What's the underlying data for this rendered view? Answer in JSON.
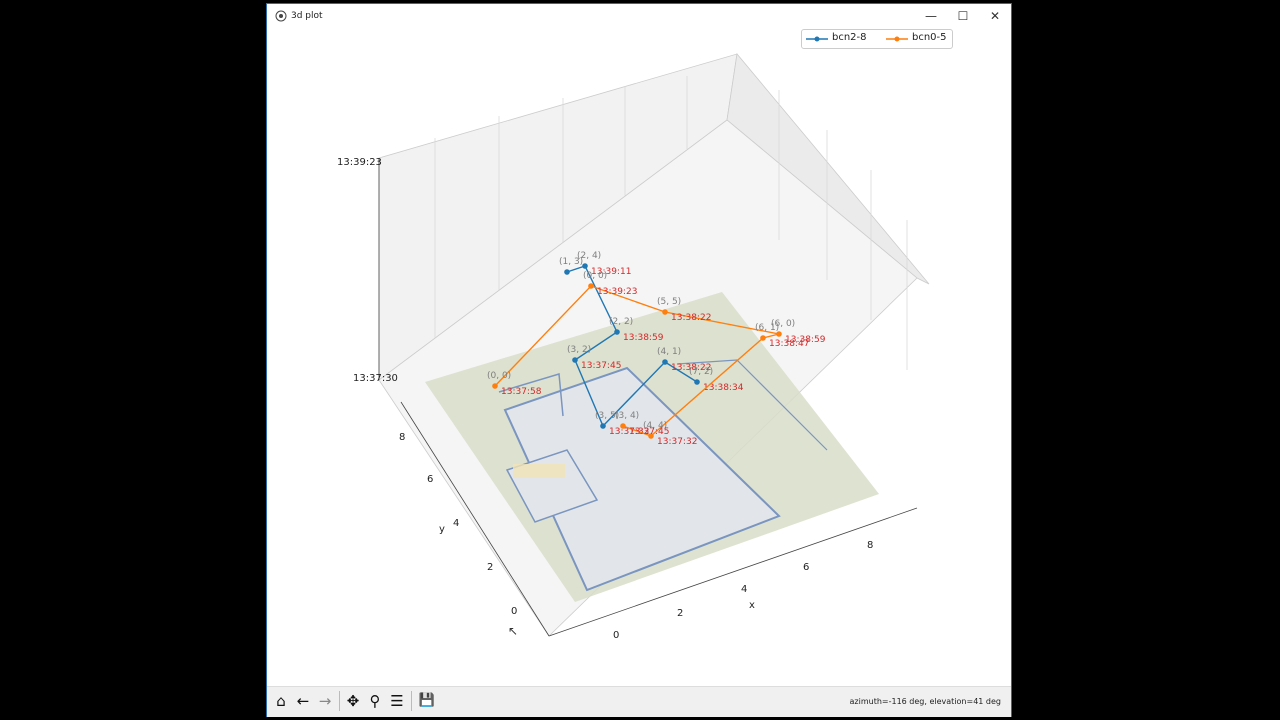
{
  "window": {
    "title": "3d plot",
    "minimize": "—",
    "maximize": "☐",
    "close": "✕"
  },
  "colors": {
    "series1": "#1f77b4",
    "series2": "#ff7f0e",
    "label": "#d62728",
    "coord": "#7f7f7f"
  },
  "toolbar": {
    "home": "⌂",
    "back": "←",
    "forward": "→",
    "pan": "✥",
    "zoom": "⚲",
    "configure": "☰",
    "save": "💾",
    "status": "azimuth=-116 deg, elevation=41 deg"
  },
  "chart_data": {
    "type": "line",
    "title": "",
    "xlabel": "x",
    "ylabel": "y",
    "zlabel": "",
    "x_ticks": [
      "0",
      "2",
      "4",
      "6",
      "8"
    ],
    "y_ticks": [
      "0",
      "2",
      "4",
      "6",
      "8"
    ],
    "z_ticks": [
      "13:37:30",
      "13:39:23"
    ],
    "legend": [
      "bcn2-8",
      "bcn0-5"
    ],
    "legend_placement": "top-right",
    "series": [
      {
        "name": "bcn2-8",
        "points": [
          {
            "coord": "(1, 3)",
            "time": ""
          },
          {
            "coord": "(2, 4)",
            "time": "13:39:11"
          },
          {
            "coord": "(2, 2)",
            "time": "13:38:59"
          },
          {
            "coord": "(3, 2)",
            "time": "13:37:45"
          },
          {
            "coord": "(3, 5)",
            "time": "13:37:32"
          },
          {
            "coord": "(4, 1)",
            "time": "13:38:22"
          },
          {
            "coord": "(7, 2)",
            "time": "13:38:34"
          }
        ]
      },
      {
        "name": "bcn0-5",
        "points": [
          {
            "coord": "(0, 0)",
            "time": "13:37:58"
          },
          {
            "coord": "(0, 0)",
            "time": "13:39:23"
          },
          {
            "coord": "(5, 5)",
            "time": "13:38:22"
          },
          {
            "coord": "(6, 0)",
            "time": "13:38:59"
          },
          {
            "coord": "(6, 1)",
            "time": "13:38:47"
          },
          {
            "coord": "(4, 4)",
            "time": "13:37:32"
          },
          {
            "coord": "(3, 4)",
            "time": "13:37:45"
          }
        ]
      }
    ]
  }
}
